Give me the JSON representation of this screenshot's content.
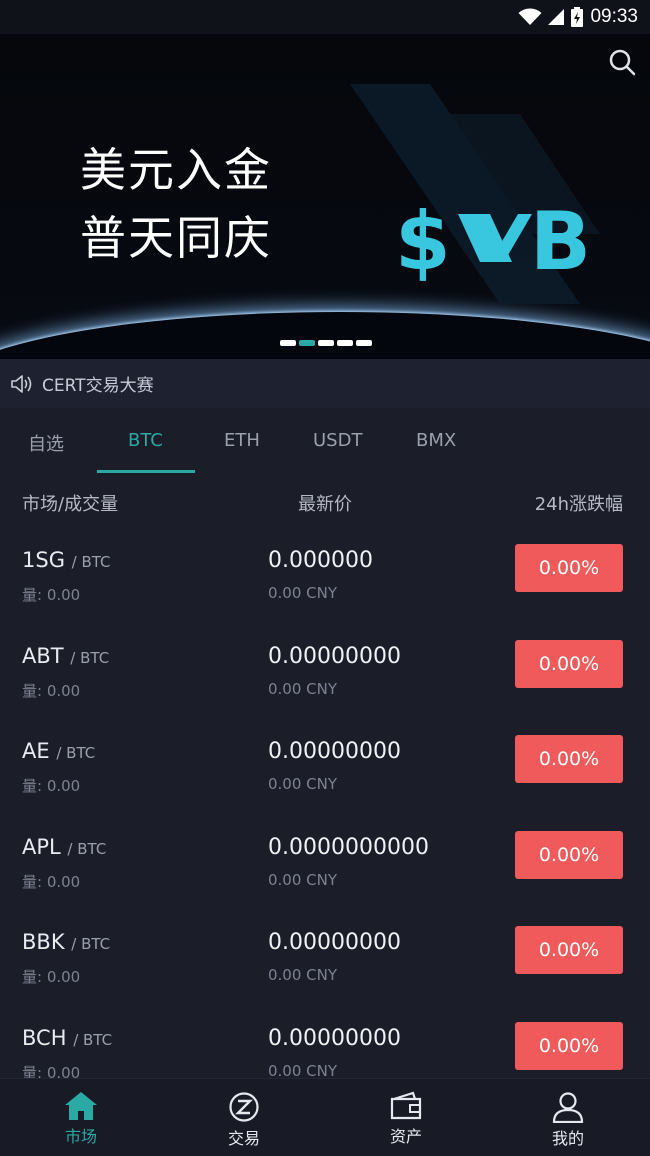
{
  "status_bar": {
    "time": "09:33"
  },
  "banner": {
    "line1": "美元入金",
    "line2": "普天同庆",
    "logo_text": "SMB",
    "slide_count": 5,
    "active_slide": 2
  },
  "notice": {
    "text": "CERT交易大赛"
  },
  "tabs": [
    {
      "label": "自选"
    },
    {
      "label": "BTC"
    },
    {
      "label": "ETH"
    },
    {
      "label": "USDT"
    },
    {
      "label": "BMX"
    }
  ],
  "active_tab": "BTC",
  "columns": {
    "market": "市场/成交量",
    "price": "最新价",
    "change": "24h涨跌幅"
  },
  "rows": [
    {
      "base": "1SG",
      "quote": "/ BTC",
      "volume": "量: 0.00",
      "price": "0.000000",
      "cny": "0.00 CNY",
      "change": "0.00%"
    },
    {
      "base": "ABT",
      "quote": "/ BTC",
      "volume": "量: 0.00",
      "price": "0.00000000",
      "cny": "0.00 CNY",
      "change": "0.00%"
    },
    {
      "base": "AE",
      "quote": "/ BTC",
      "volume": "量: 0.00",
      "price": "0.00000000",
      "cny": "0.00 CNY",
      "change": "0.00%"
    },
    {
      "base": "APL",
      "quote": "/ BTC",
      "volume": "量: 0.00",
      "price": "0.0000000000",
      "cny": "0.00 CNY",
      "change": "0.00%"
    },
    {
      "base": "BBK",
      "quote": "/ BTC",
      "volume": "量: 0.00",
      "price": "0.00000000",
      "cny": "0.00 CNY",
      "change": "0.00%"
    },
    {
      "base": "BCH",
      "quote": "/ BTC",
      "volume": "量: 0.00",
      "price": "0.00000000",
      "cny": "0.00 CNY",
      "change": "0.00%"
    }
  ],
  "nav": [
    {
      "label": "市场",
      "icon": "home-icon"
    },
    {
      "label": "交易",
      "icon": "exchange-icon"
    },
    {
      "label": "资产",
      "icon": "wallet-icon"
    },
    {
      "label": "我的",
      "icon": "user-icon"
    }
  ],
  "colors": {
    "accent": "#2aa9a5",
    "change_badge": "#f05a5a",
    "background": "#1b1d29"
  }
}
